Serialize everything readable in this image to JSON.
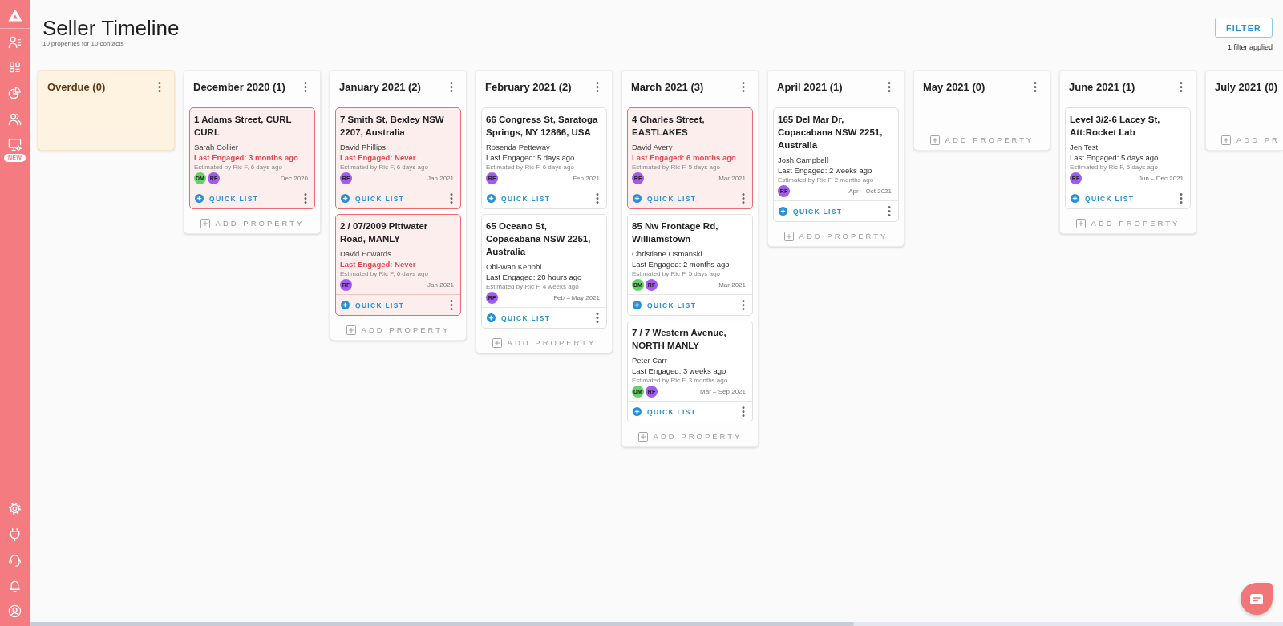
{
  "sidebar": {
    "new_badge": "NEW"
  },
  "header": {
    "title": "Seller Timeline",
    "subtitle": "10 properties for 10 contacts"
  },
  "filter": {
    "button": "FILTER",
    "note": "1 filter applied"
  },
  "columns": [
    {
      "kind": "overdue",
      "title": "Overdue (0)",
      "partial": false
    },
    {
      "kind": "month",
      "title": "December 2020 (1)",
      "partial": false,
      "cards": [
        {
          "address": "1 Adams Street, CURL CURL",
          "contact": "Sarah Collier",
          "engaged": "Last Engaged: 3 months ago",
          "alert": true,
          "estimate": "Estimated by Ric F, 6 days ago",
          "avatars": [
            {
              "initials": "DM",
              "color": "#66d266"
            },
            {
              "initials": "RF",
              "color": "#a35af0"
            }
          ],
          "period": "Dec 2020",
          "action": "QUICK LIST"
        }
      ],
      "add_label": "ADD PROPERTY"
    },
    {
      "kind": "month",
      "title": "January 2021 (2)",
      "partial": false,
      "cards": [
        {
          "address": "7 Smith St, Bexley NSW 2207, Australia",
          "contact": "David Phillips",
          "engaged": "Last Engaged: Never",
          "alert": true,
          "estimate": "Estimated by Ric F, 6 days ago",
          "avatars": [
            {
              "initials": "RF",
              "color": "#a35af0"
            }
          ],
          "period": "Jan 2021",
          "action": "QUICK LIST"
        },
        {
          "address": "2 / 07/2009 Pittwater Road, MANLY",
          "contact": "David Edwards",
          "engaged": "Last Engaged: Never",
          "alert": true,
          "estimate": "Estimated by Ric F, 6 days ago",
          "avatars": [
            {
              "initials": "RF",
              "color": "#a35af0"
            }
          ],
          "period": "Jan 2021",
          "action": "QUICK LIST"
        }
      ],
      "add_label": "ADD PROPERTY"
    },
    {
      "kind": "month",
      "title": "February 2021 (2)",
      "partial": false,
      "cards": [
        {
          "address": "66 Congress St, Saratoga Springs, NY 12866, USA",
          "contact": "Rosenda Petteway",
          "engaged": "Last Engaged: 5 days ago",
          "alert": false,
          "estimate": "Estimated by Ric F, 6 days ago",
          "avatars": [
            {
              "initials": "RF",
              "color": "#a35af0"
            }
          ],
          "period": "Feb 2021",
          "action": "QUICK LIST"
        },
        {
          "address": "65 Oceano St, Copacabana NSW 2251, Australia",
          "contact": "Obi-Wan Kenobi",
          "engaged": "Last Engaged: 20 hours ago",
          "alert": false,
          "estimate": "Estimated by Ric F, 4 weeks ago",
          "avatars": [
            {
              "initials": "RF",
              "color": "#a35af0"
            }
          ],
          "period": "Feb – May 2021",
          "action": "QUICK LIST"
        }
      ],
      "add_label": "ADD PROPERTY"
    },
    {
      "kind": "month",
      "title": "March 2021 (3)",
      "partial": false,
      "cards": [
        {
          "address": "4 Charles Street, EASTLAKES",
          "contact": "David Avery",
          "engaged": "Last Engaged: 6 months ago",
          "alert": true,
          "estimate": "Estimated by Ric F, 5 days ago",
          "avatars": [
            {
              "initials": "RF",
              "color": "#a35af0"
            }
          ],
          "period": "Mar 2021",
          "action": "QUICK LIST"
        },
        {
          "address": "85 Nw Frontage Rd, Williamstown",
          "contact": "Christiane Osmanski",
          "engaged": "Last Engaged: 2 months ago",
          "alert": false,
          "estimate": "Estimated by Ric F, 5 days ago",
          "avatars": [
            {
              "initials": "DM",
              "color": "#66d266"
            },
            {
              "initials": "RF",
              "color": "#a35af0"
            }
          ],
          "period": "Mar 2021",
          "action": "QUICK LIST"
        },
        {
          "address": "7 / 7 Western Avenue, NORTH MANLY",
          "contact": "Peter Carr",
          "engaged": "Last Engaged: 3 weeks ago",
          "alert": false,
          "estimate": "Estimated by Ric F, 3 months ago",
          "avatars": [
            {
              "initials": "DM",
              "color": "#66d266"
            },
            {
              "initials": "RF",
              "color": "#a35af0"
            }
          ],
          "period": "Mar – Sep 2021",
          "action": "QUICK LIST"
        }
      ],
      "add_label": "ADD PROPERTY"
    },
    {
      "kind": "month",
      "title": "April 2021 (1)",
      "partial": false,
      "cards": [
        {
          "address": "165 Del Mar Dr, Copacabana NSW 2251, Australia",
          "contact": "Josh Campbell",
          "engaged": "Last Engaged: 2 weeks ago",
          "alert": false,
          "estimate": "Estimated by Ric F, 2 months ago",
          "avatars": [
            {
              "initials": "RF",
              "color": "#a35af0"
            }
          ],
          "period": "Apr – Oct 2021",
          "action": "QUICK LIST"
        }
      ],
      "add_label": "ADD PROPERTY"
    },
    {
      "kind": "month",
      "title": "May 2021 (0)",
      "partial": false,
      "add_label": "ADD PROPERTY"
    },
    {
      "kind": "month",
      "title": "June 2021 (1)",
      "partial": false,
      "cards": [
        {
          "address": "Level 3/2-6 Lacey St, Att:Rocket Lab",
          "contact": "Jen Test",
          "engaged": "Last Engaged: 5 days ago",
          "alert": false,
          "estimate": "Estimated by Ric F, 5 days ago",
          "avatars": [
            {
              "initials": "RF",
              "color": "#a35af0"
            }
          ],
          "period": "Jun – Dec 2021",
          "action": "QUICK LIST"
        }
      ],
      "add_label": "ADD PROPERTY"
    },
    {
      "kind": "month",
      "title": "July 2021 (0)",
      "partial": true,
      "add_label": "ADD PR"
    }
  ]
}
